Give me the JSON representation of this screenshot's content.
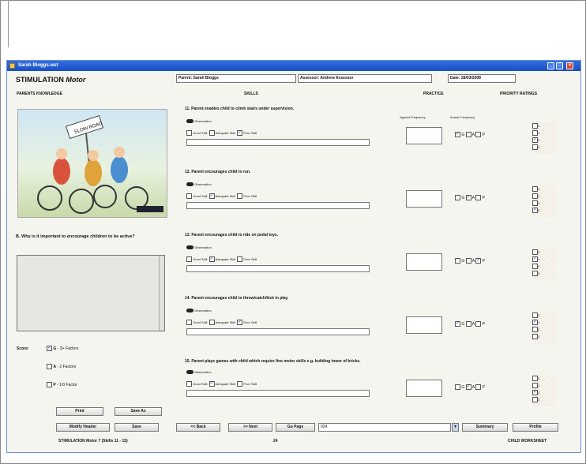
{
  "window": {
    "title": "Sarah Bloggs.wst"
  },
  "header": {
    "title_main": "STIMULATION",
    "title_sub": "Motor",
    "parent": "Parent: Sarah Bloggs",
    "assessor": "Assessor: Andrew Assessor",
    "date": "Date: 28/03/2008"
  },
  "columns": {
    "knowledge": "PARENTS KNOWLEDGE",
    "skills": "SKILLS",
    "practice": "PRACTICE",
    "priority": "PRIORITY RATINGS",
    "agreed_freq": "Agreed Frequency",
    "actual_freq": "Actual Frequency"
  },
  "picture": {
    "caption": "SLOW ROAD"
  },
  "question": {
    "text": "B. Why is it important to encourage children to be active?"
  },
  "score": {
    "label": "Score:",
    "options": [
      {
        "key": "G",
        "text": "- 3+ Factors",
        "checked": true
      },
      {
        "key": "A",
        "text": "- 2 Factors",
        "checked": false
      },
      {
        "key": "P",
        "text": "- 1/0 Factor",
        "checked": false
      }
    ]
  },
  "observation_label": "Observation",
  "skill_options": [
    "Good Skill",
    "Adequate Skill",
    "Poor Skill"
  ],
  "gap_options": [
    "G",
    "A",
    "P"
  ],
  "priority_options": [
    "C",
    "1",
    "2",
    "3"
  ],
  "skills": [
    {
      "text": "11. Parent enables child to climb stairs under supervision.",
      "checked_skill": "Poor Skill",
      "gap": "G",
      "priority": "2"
    },
    {
      "text": "12. Parent encourages child to run.",
      "checked_skill": "Adequate Skill",
      "gap": "A",
      "priority": "3"
    },
    {
      "text": "13. Parent encourages child to ride on pedal toys.",
      "checked_skill": "Adequate Skill",
      "gap": "P",
      "priority": "1"
    },
    {
      "text": "14. Parent encourages child to throw/catch/kick in play.",
      "checked_skill": "Poor Skill",
      "gap": "G",
      "priority": "1"
    },
    {
      "text": "15. Parent plays games with child which require fine motor skills e.g. building tower of bricks.",
      "checked_skill": "Adequate Skill",
      "gap": "A",
      "priority": "2"
    }
  ],
  "buttons": {
    "print": "Print",
    "save_as": "Save As",
    "modify_header": "Modify Header",
    "save": "Save",
    "back": "<< Back",
    "next": ">> Next",
    "go_page": "Go Page",
    "summary": "Summary",
    "profile": "Profile"
  },
  "go_page_value": "024",
  "footer": {
    "left": "STIMULATION Motor 7 (Skills 11 - 15)",
    "page": "24",
    "right": "CHILD WORKSHEET"
  }
}
